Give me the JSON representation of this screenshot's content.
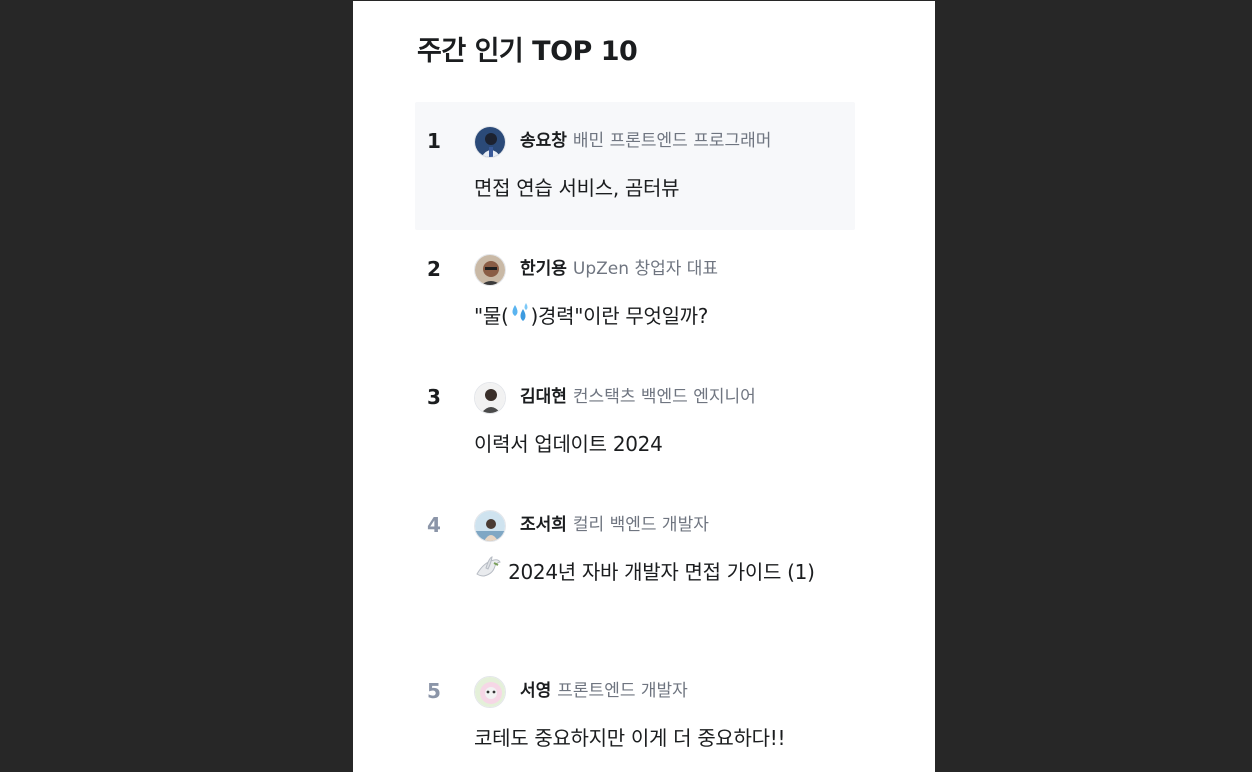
{
  "section": {
    "title": "주간 인기 TOP 10"
  },
  "items": [
    {
      "rank": "1",
      "author": "송요창",
      "role": "배민 프론트엔드 프로그래머",
      "title": "면접 연습 서비스, 곰터뷰",
      "rank_color": "#1b1d1f",
      "avatar_icon": "avatar-photo"
    },
    {
      "rank": "2",
      "author": "한기용",
      "role": "UpZen 창업자 대표",
      "title_before": "\"물(",
      "title_emoji": "sweat-droplets",
      "title_after": ")경력\"이란 무엇일까?",
      "rank_color": "#1b1d1f",
      "avatar_icon": "avatar-photo"
    },
    {
      "rank": "3",
      "author": "김대현",
      "role": "컨스택츠 백엔드 엔지니어",
      "title": "이력서 업데이트 2024",
      "rank_color": "#1b1d1f",
      "avatar_icon": "avatar-photo"
    },
    {
      "rank": "4",
      "author": "조서희",
      "role": "컬리 백엔드 개발자",
      "title_emoji": "dove",
      "title": "2024년 자바 개발자 면접 가이드 (1)",
      "rank_color": "#8b95a8",
      "avatar_icon": "avatar-photo"
    },
    {
      "rank": "5",
      "author": "서영",
      "role": "프론트엔드 개발자",
      "title": "코테도 중요하지만 이게 더 중요하다!!",
      "rank_color": "#8b95a8",
      "avatar_icon": "avatar-illustration"
    }
  ]
}
